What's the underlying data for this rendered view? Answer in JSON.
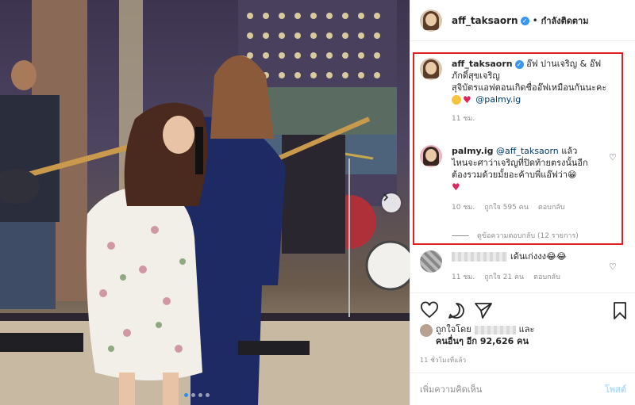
{
  "header": {
    "username": "aff_taksaorn",
    "verified_badge": "✓",
    "separator": "•",
    "follow_status": "กำลังติดตาม"
  },
  "caption": {
    "username": "aff_taksaorn",
    "line1": "อ๊ฟ ปานเจริญ & อ๊ฟ",
    "line2": "ภักดิ์สุขเจริญ",
    "line3": "สุจิบัตรแอฟตอนเกิดชื่ออ๊ฟเหมือนกันนะคะ",
    "mention": "@palmy.ig",
    "time": "11 ชม."
  },
  "comment1": {
    "username": "palmy.ig",
    "mention": "@aff_taksaorn",
    "text_after_mention": " แล้ว",
    "line2": "ไหนจะศาว่าเจริญที่ปิดท้ายตรงนั้นอีก",
    "line3": "ต้องรวมด้วยมั้ยอะค้าบพี่แอ๊ฟว่า😁",
    "time": "10 ชม.",
    "likes": "ถูกใจ 595 คน",
    "reply": "ตอบกลับ",
    "view_replies": "ดูข้อความตอบกลับ (12 รายการ)"
  },
  "comment2": {
    "text": "เด้นเก่งงง",
    "emoji": "😂😂",
    "time": "11 ชม.",
    "likes": "ถูกใจ 21 คน",
    "reply": "ตอบกลับ"
  },
  "liked_by": {
    "prefix": "ถูกใจโดย",
    "and": "และ",
    "others": "คนอื่นๆ อีก 92,626 คน"
  },
  "time_ago": "11 ชั่วโมงที่แล้ว",
  "add_comment": {
    "placeholder": "เพิ่มความคิดเห็น",
    "post_label": "โพสต์"
  },
  "carousel": {
    "count": 4,
    "active": 1
  },
  "colors": {
    "highlight": "#e02020",
    "link": "#00376b",
    "verified": "#3897f0",
    "post_disabled": "#b2dffc",
    "carousel_active": "#2f8de4"
  }
}
